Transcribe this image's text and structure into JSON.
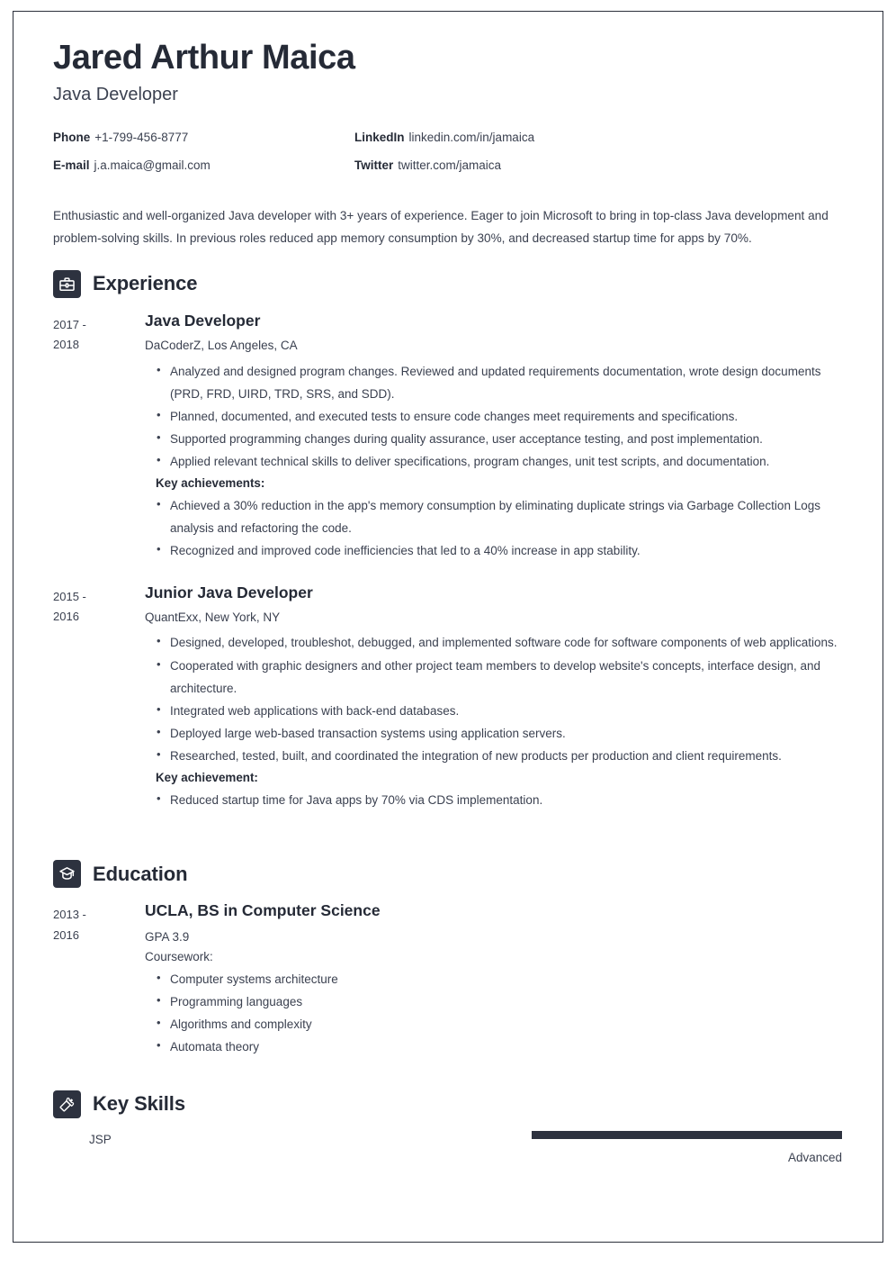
{
  "header": {
    "name": "Jared Arthur Maica",
    "job_title": "Java Developer"
  },
  "contact": [
    {
      "label": "Phone",
      "value": "+1-799-456-8777"
    },
    {
      "label": "LinkedIn",
      "value": "linkedin.com/in/jamaica"
    },
    {
      "label": "E-mail",
      "value": "j.a.maica@gmail.com"
    },
    {
      "label": "Twitter",
      "value": "twitter.com/jamaica"
    }
  ],
  "summary": "Enthusiastic and well-organized Java developer with 3+ years of experience. Eager to join Microsoft to bring in top-class Java development and problem-solving skills. In previous roles reduced app memory consumption by 30%, and decreased startup time for apps by 70%.",
  "sections": {
    "experience": {
      "title": "Experience",
      "icon": "briefcase-icon",
      "entries": [
        {
          "date_start": "2017 -",
          "date_end": "2018",
          "role": "Java Developer",
          "org": "DaCoderZ, Los Angeles, CA",
          "bullets": [
            "Analyzed and designed program changes. Reviewed and updated requirements documentation, wrote design documents (PRD, FRD, UIRD, TRD, SRS, and SDD).",
            "Planned, documented, and executed tests to ensure code changes meet requirements and specifications.",
            "Supported programming changes during quality assurance, user acceptance testing, and post implementation.",
            "Applied relevant technical skills to deliver specifications, program changes, unit test scripts, and documentation."
          ],
          "achievements_label": "Key achievements:",
          "achievements": [
            "Achieved a 30% reduction in the app's memory consumption by eliminating duplicate strings via Garbage Collection Logs analysis and refactoring the code.",
            "Recognized and improved code inefficiencies that led to a 40% increase in app stability."
          ]
        },
        {
          "date_start": "2015 -",
          "date_end": "2016",
          "role": "Junior Java Developer",
          "org": "QuantExx, New York, NY",
          "bullets": [
            "Designed, developed, troubleshot, debugged, and implemented software code for software components of web applications.",
            "Cooperated with graphic designers and other project team members to develop website's concepts, interface design, and architecture.",
            "Integrated web applications with back-end databases.",
            "Deployed large web-based transaction systems using application servers.",
            "Researched, tested, built, and coordinated the integration of new products per production and client requirements."
          ],
          "achievements_label": "Key achievement:",
          "achievements": [
            "Reduced startup time for Java apps by 70% via CDS implementation."
          ]
        }
      ]
    },
    "education": {
      "title": "Education",
      "icon": "graduation-cap-icon",
      "entries": [
        {
          "date_start": "2013 -",
          "date_end": "2016",
          "degree": "UCLA, BS in Computer Science",
          "gpa": "GPA 3.9",
          "coursework_label": "Coursework:",
          "coursework": [
            "Computer systems architecture",
            "Programming languages",
            "Algorithms and complexity",
            "Automata theory"
          ]
        }
      ]
    },
    "key_skills": {
      "title": "Key Skills",
      "icon": "puzzle-piece-icon",
      "skills": [
        {
          "name": "JSP",
          "level_label": "Advanced",
          "level_percent": 100
        }
      ]
    }
  },
  "colors": {
    "ink": "#2d323f",
    "body_text": "#3b4150",
    "page_border": "#2b2f3a"
  }
}
